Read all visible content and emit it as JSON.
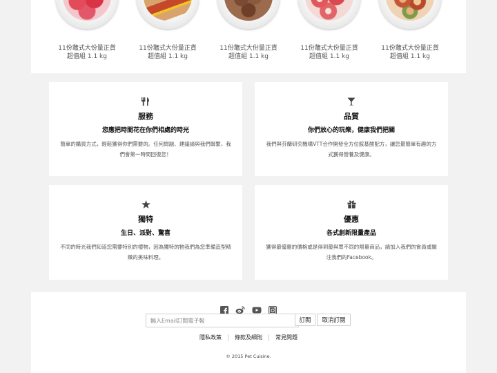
{
  "products": [
    {
      "name": "11份鼈式大份量正貨",
      "size": "超值組 1.1 kg",
      "image": "strawberry-chips"
    },
    {
      "name": "11份鼈式大份量正貨",
      "size": "超值組 1.1 kg",
      "image": "hot-dogs"
    },
    {
      "name": "11份鼈式大份量正貨",
      "size": "超值組 1.1 kg",
      "image": "bone-biscuits"
    },
    {
      "name": "11份鼈式大份量正貨",
      "size": "超值組 1.1 kg",
      "image": "donut-treats"
    },
    {
      "name": "11份鼈式大份量正貨",
      "size": "超值組 1.1 kg",
      "image": "jerky-rolls"
    }
  ],
  "features": [
    {
      "icon": "cutlery-icon",
      "title": "服務",
      "subtitle": "您應把時間花在你們相處的時光",
      "description": "簡單的購買方式，輕鬆獲得你們需要的。任何問題、建議請與我們聯繫，我們會第一時間回復您！"
    },
    {
      "icon": "cocktail-icon",
      "title": "品質",
      "subtitle": "你們放心的玩樂，健康我們把關",
      "description": "我們與芬蘭研究機構VTT合作開發全方位胺基酸配方，讓您最簡單有趣的方式獲得營養及健康。"
    },
    {
      "icon": "star-icon",
      "title": "獨特",
      "subtitle": "生日、派對、驚喜",
      "description": "不同的時光我們知道您需要特別的禮物，因為獨特的牠我們為您準備造型精緻的美味料理。"
    },
    {
      "icon": "gift-icon",
      "title": "優惠",
      "subtitle": "各式創新限量產品",
      "description": "獲得最優惠的價格或是得到最與眾不同的限量商品，請加入我們的會員或關注我們的Facebook。"
    }
  ],
  "footer": {
    "social": [
      "facebook-icon",
      "weibo-icon",
      "youtube-icon",
      "instagram-icon"
    ],
    "email_placeholder": "輸入Email訂閱電子報",
    "subscribe_label": "訂閱",
    "unsubscribe_label": "取消訂閱",
    "links": [
      "隱私政策",
      "條款及細則",
      "常見問題"
    ],
    "copyright": "© 2015 Pet Cuisine."
  },
  "colors": {
    "background": "#f2f2f2",
    "panel": "#ffffff",
    "text": "#222222",
    "muted": "#555555",
    "icon": "#444444"
  }
}
